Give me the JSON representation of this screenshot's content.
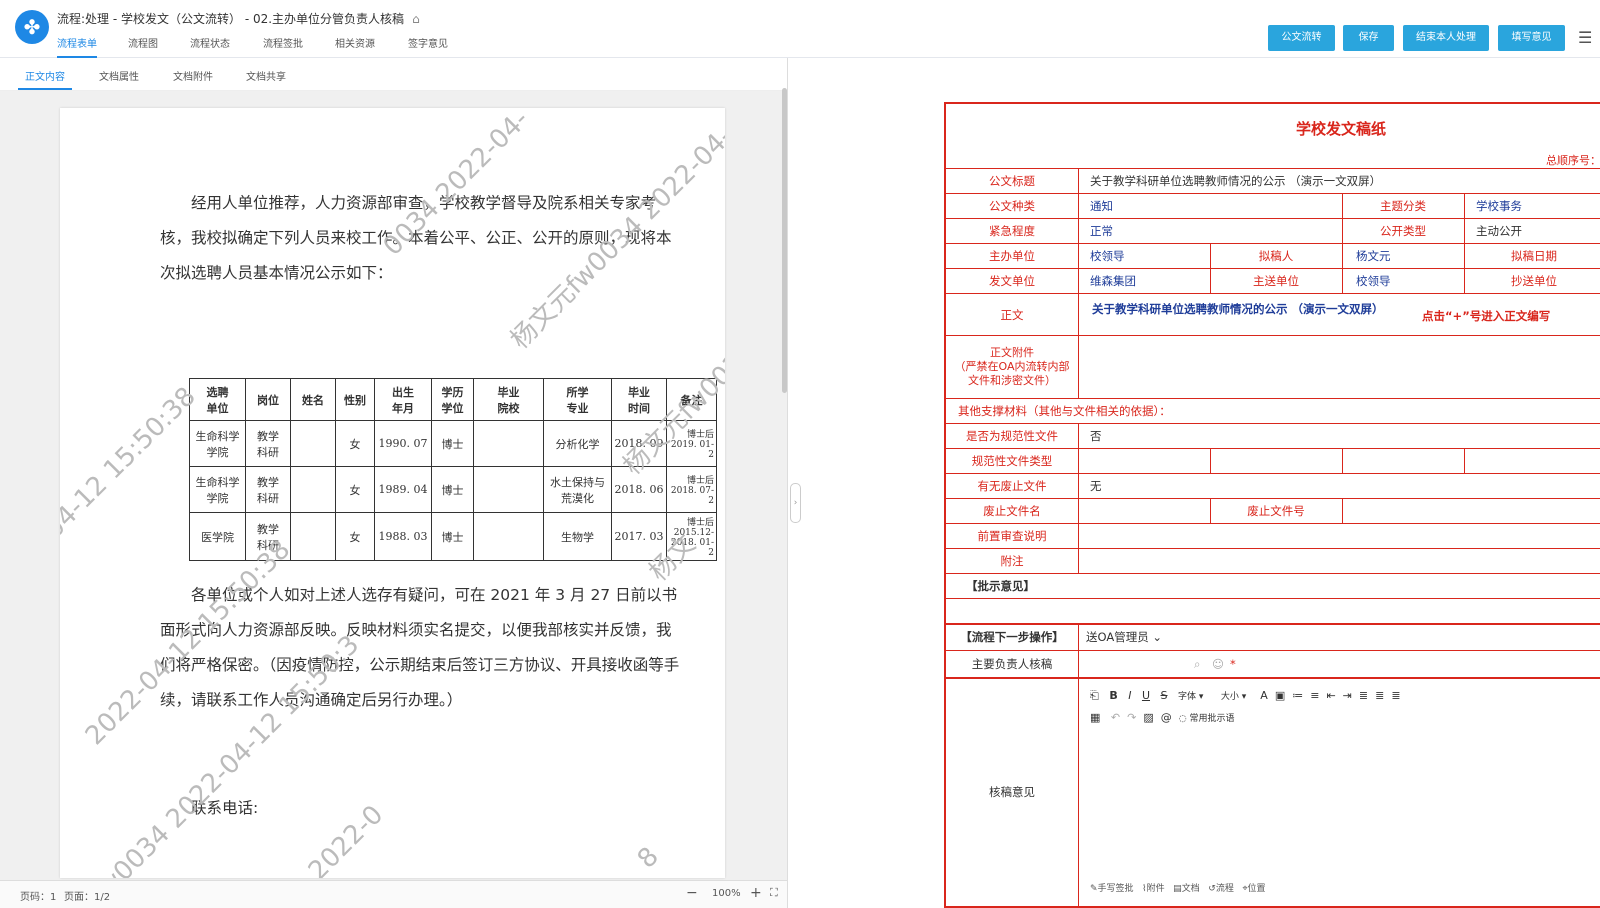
{
  "header": {
    "title": "流程:处理 - 学校发文（公文流转） - 02.主办单位分管负责人核稿",
    "tag_icon": "tag-icon",
    "tabs": [
      "流程表单",
      "流程图",
      "流程状态",
      "流程签批",
      "相关资源",
      "签字意见"
    ],
    "buttons": [
      "公文流转",
      "保存",
      "结束本人处理",
      "填写意见"
    ]
  },
  "left_panel": {
    "subtabs": [
      "正文内容",
      "文档属性",
      "文档附件",
      "文档共享"
    ],
    "doc": {
      "para1": "经用人单位推荐，人力资源部审查，学校教学督导及院系相关专家考核，我校拟确定下列人员来校工作。本着公平、公正、公开的原则，现将本次拟选聘人员基本情况公示如下：",
      "para2": "各单位或个人如对上述人选存有疑问，可在 2021 年 3 月 27 日前以书面形式向人力资源部反映。反映材料须实名提交，以便我部核实并反馈，我们将严格保密。（因疫情防控，公示期结束后签订三方协议、开具接收函等手续，请联系工作人员沟通确定后另行办理。）",
      "para3": "联系电话:",
      "watermarks": [
        "0034 2022-04-",
        "杨文元fw0034 2022-04-",
        "杨文元fw0034 2022-04-1",
        "04-12 15:50:38",
        "2022-04-12 15:50:38",
        "元fw0034 2022-04-12 15:50:3",
        "杨文",
        "2022-0",
        "8"
      ],
      "table": {
        "headers": [
          "选聘\n单位",
          "岗位",
          "姓名",
          "性别",
          "出生\n年月",
          "学历\n学位",
          "毕业\n院校",
          "所学\n专业",
          "毕业\n时间",
          "备注"
        ],
        "rows": [
          [
            "生命科学\n学院",
            "教学\n科研",
            "",
            "女",
            "1990. 07",
            "博士",
            "",
            "分析化学",
            "2018. 09",
            "博士后\n2019. 01-2"
          ],
          [
            "生命科学\n学院",
            "教学\n科研",
            "",
            "女",
            "1989. 04",
            "博士",
            "",
            "水土保持与\n荒漠化",
            "2018. 06",
            "博士后\n2018. 07-2"
          ],
          [
            "医学院",
            "教学\n科研",
            "",
            "女",
            "1988. 03",
            "博士",
            "",
            "生物学",
            "2017. 03",
            "博士后\n2015.12-\n2018. 01-2"
          ]
        ]
      }
    },
    "status": {
      "page_no": "页码：1",
      "pages": "页面：1/2",
      "zoom": "100%"
    }
  },
  "form": {
    "title": "学校发文稿纸",
    "serial_label": "总顺序号：",
    "rows": {
      "title_label": "公文标题",
      "title_value": "关于教学科研单位选聘教师情况的公示 （演示一文双屏）",
      "type_label": "公文种类",
      "type_value": "通知",
      "topic_label": "主题分类",
      "topic_value": "学校事务",
      "urgency_label": "紧急程度",
      "urgency_value": "正常",
      "public_label": "公开类型",
      "public_value": "主动公开",
      "host_label": "主办单位",
      "host_value": "校领导",
      "drafter_label": "拟稿人",
      "drafter_value": "杨文元",
      "date_label": "拟稿日期",
      "issuer_label": "发文单位",
      "issuer_value": "维森集团",
      "send_label": "主送单位",
      "send_value": "校领导",
      "cc_label": "抄送单位",
      "body_label": "正文",
      "body_value": "关于教学科研单位选聘教师情况的公示 （演示一文双屏）",
      "body_hint": "点击“+”号进入正文编写",
      "attach_label": "正文附件\n（严禁在OA内流转内部\n文件和涉密文件）",
      "other_label": "其他支撑材料（其他与文件相关的依据）：",
      "norm_label": "是否为规范性文件",
      "norm_value": "否",
      "normtype_label": "规范性文件类型",
      "abolish_label": "有无废止文件",
      "abolish_value": "无",
      "abname_label": "废止文件名",
      "abno_label": "废止文件号",
      "review_label": "前置审查说明",
      "note_label": "附注",
      "opinion_label": "【批示意见】",
      "next_label": "【流程下一步操作】",
      "next_value": "送OA管理员",
      "resp_label": "主要负责人核稿",
      "verify_label": "核稿意见"
    },
    "editor": {
      "font_label": "字体",
      "size_label": "大小",
      "common_phrase": "常用批示语",
      "footer": [
        "手写签批",
        "附件",
        "文档",
        "流程",
        "位置"
      ]
    }
  },
  "colors": {
    "accent": "#2aa5dd",
    "form_red": "#d9261c",
    "link_blue": "#1e88e5"
  }
}
